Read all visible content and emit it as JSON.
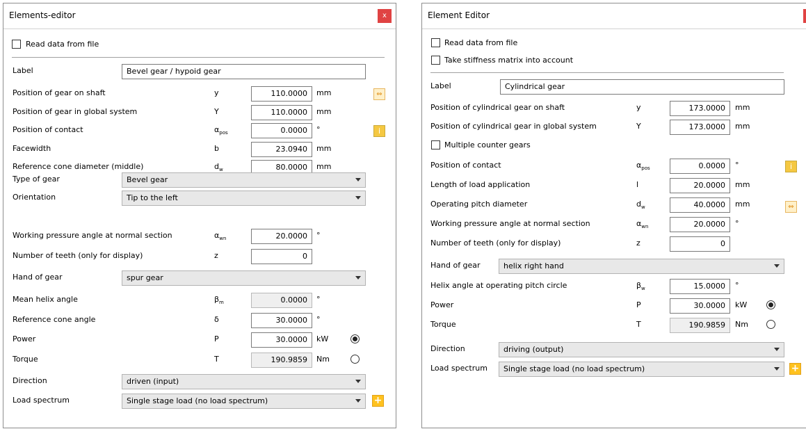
{
  "editorA": {
    "title": "Elements-editor",
    "close_label": "x",
    "read_data_label": "Read data from file",
    "label_field": {
      "label": "Label",
      "value": "Bevel gear / hypoid gear"
    },
    "rows": [
      {
        "label": "Position of gear on shaft",
        "symbol": "y",
        "sub": "",
        "value": "110.0000",
        "unit": "mm",
        "readonly": false
      },
      {
        "label": "Position of gear in global system",
        "symbol": "Y",
        "sub": "",
        "value": "110.0000",
        "unit": "mm",
        "readonly": false
      },
      {
        "label": "Position of contact",
        "symbol": "α",
        "sub": "pos",
        "value": "0.0000",
        "unit": "°",
        "readonly": false
      },
      {
        "label": "Facewidth",
        "symbol": "b",
        "sub": "",
        "value": "23.0940",
        "unit": "mm",
        "readonly": false
      },
      {
        "label": "Reference cone diameter (middle)",
        "symbol": "d",
        "sub": "w",
        "value": "80.0000",
        "unit": "mm",
        "readonly": false
      }
    ],
    "type_of_gear": {
      "label": "Type of gear",
      "value": "Bevel gear"
    },
    "orientation": {
      "label": "Orientation",
      "value": "Tip to the left"
    },
    "rows2": [
      {
        "label": "Working pressure angle at normal section",
        "symbol": "α",
        "sub": "wn",
        "value": "20.0000",
        "unit": "°",
        "readonly": false
      },
      {
        "label": "Number of teeth (only for display)",
        "symbol": "z",
        "sub": "",
        "value": "0",
        "unit": "",
        "readonly": false
      }
    ],
    "hand_of_gear": {
      "label": "Hand of gear",
      "value": "spur gear"
    },
    "rows3": [
      {
        "label": "Mean helix angle",
        "symbol": "β",
        "sub": "m",
        "value": "0.0000",
        "unit": "°",
        "readonly": true
      },
      {
        "label": "Reference cone angle",
        "symbol": "δ",
        "sub": "",
        "value": "30.0000",
        "unit": "°",
        "readonly": false
      },
      {
        "label": "Power",
        "symbol": "P",
        "sub": "",
        "value": "30.0000",
        "unit": "kW",
        "readonly": false
      },
      {
        "label": "Torque",
        "symbol": "T",
        "sub": "",
        "value": "190.9859",
        "unit": "Nm",
        "readonly": true
      }
    ],
    "direction": {
      "label": "Direction",
      "value": "driven (input)"
    },
    "load_spectrum": {
      "label": "Load spectrum",
      "value": "Single stage load (no load spectrum)"
    }
  },
  "editorB": {
    "title": "Element Editor",
    "close_label": "x",
    "read_data_label": "Read data from file",
    "stiffness_label": "Take stiffness matrix into account",
    "label_field": {
      "label": "Label",
      "value": "Cylindrical gear"
    },
    "rows": [
      {
        "label": "Position of cylindrical gear on shaft",
        "symbol": "y",
        "sub": "",
        "value": "173.0000",
        "unit": "mm",
        "readonly": false
      },
      {
        "label": "Position of cylindrical gear in global system",
        "symbol": "Y",
        "sub": "",
        "value": "173.0000",
        "unit": "mm",
        "readonly": false
      }
    ],
    "multiple_counter_label": "Multiple counter gears",
    "rows2": [
      {
        "label": "Position of contact",
        "symbol": "α",
        "sub": "pos",
        "value": "0.0000",
        "unit": "°",
        "readonly": false
      },
      {
        "label": "Length of load application",
        "symbol": "l",
        "sub": "",
        "value": "20.0000",
        "unit": "mm",
        "readonly": false
      },
      {
        "label": "Operating pitch diameter",
        "symbol": "d",
        "sub": "w",
        "value": "40.0000",
        "unit": "mm",
        "readonly": false
      },
      {
        "label": "Working pressure angle at normal section",
        "symbol": "α",
        "sub": "wn",
        "value": "20.0000",
        "unit": "°",
        "readonly": false
      },
      {
        "label": "Number of teeth (only for display)",
        "symbol": "z",
        "sub": "",
        "value": "0",
        "unit": "",
        "readonly": false
      }
    ],
    "hand_of_gear": {
      "label": "Hand of gear",
      "value": "helix right hand"
    },
    "rows3": [
      {
        "label": "Helix angle at operating pitch circle",
        "symbol": "β",
        "sub": "w",
        "value": "15.0000",
        "unit": "°",
        "readonly": false
      },
      {
        "label": "Power",
        "symbol": "P",
        "sub": "",
        "value": "30.0000",
        "unit": "kW",
        "readonly": false
      },
      {
        "label": "Torque",
        "symbol": "T",
        "sub": "",
        "value": "190.9859",
        "unit": "Nm",
        "readonly": true
      }
    ],
    "direction": {
      "label": "Direction",
      "value": "driving (output)"
    },
    "load_spectrum": {
      "label": "Load spectrum",
      "value": "Single stage load (no load spectrum)"
    }
  },
  "colors": {
    "close_button": "#e04343",
    "info_button": "#f5c842",
    "plus_button": "#ffc21f",
    "readonly_field": "#efefef"
  },
  "icons": {
    "info": "i",
    "plus": "+",
    "swap": "⇔"
  }
}
